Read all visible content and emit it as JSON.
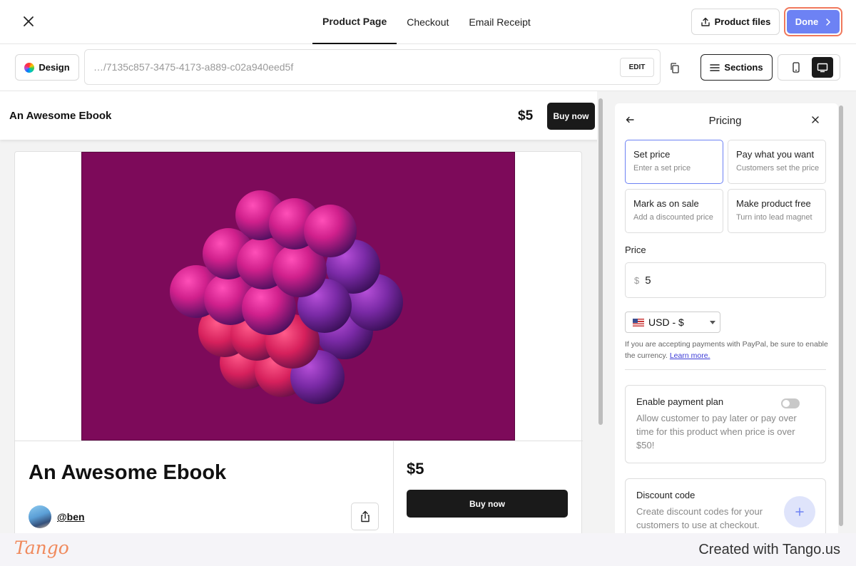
{
  "topbar": {
    "tabs": [
      {
        "label": "Product Page",
        "active": true
      },
      {
        "label": "Checkout",
        "active": false
      },
      {
        "label": "Email Receipt",
        "active": false
      }
    ],
    "product_files_label": "Product files",
    "done_label": "Done"
  },
  "toolbar": {
    "design_label": "Design",
    "url": "…/7135c857-3475-4173-a889-c02a940eed5f",
    "edit_label": "EDIT",
    "sections_label": "Sections",
    "device": "desktop"
  },
  "preview": {
    "header_title": "An Awesome Ebook",
    "header_price": "$5",
    "header_buy_label": "Buy now",
    "product_title": "An Awesome Ebook",
    "author": "@ben",
    "price": "$5",
    "buy_label": "Buy now",
    "image_color": "#7d0a5a"
  },
  "pricing": {
    "title": "Pricing",
    "options": [
      {
        "title": "Set price",
        "subtitle": "Enter a set price",
        "selected": true
      },
      {
        "title": "Pay what you want",
        "subtitle": "Customers set the price",
        "selected": false
      },
      {
        "title": "Mark as on sale",
        "subtitle": "Add a discounted price",
        "selected": false
      },
      {
        "title": "Make product free",
        "subtitle": "Turn into lead magnet",
        "selected": false
      }
    ],
    "price_label": "Price",
    "currency_symbol": "$",
    "price_value": "5",
    "currency": "USD - $",
    "paypal_note": "If you are accepting payments with PayPal, be sure to enable the currency.",
    "learn_more": "Learn more.",
    "payment_plan": {
      "title": "Enable payment plan",
      "description": "Allow customer to pay later or pay over time for this product when price is over $50!",
      "enabled": false
    },
    "discount": {
      "title": "Discount code",
      "description": "Create discount codes for your customers to use at checkout."
    }
  },
  "footer": {
    "logo": "Tango",
    "created_with": "Created with Tango.us"
  },
  "colors": {
    "accent": "#6d82f4",
    "done_outline": "#f0785c",
    "dark_button": "#1a1a1a",
    "tango_orange": "#f08a5d"
  }
}
